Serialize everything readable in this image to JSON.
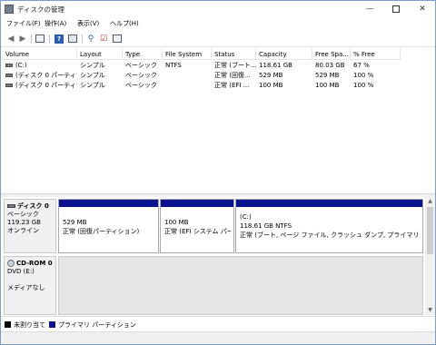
{
  "window": {
    "title": "ディスクの管理",
    "controls": {
      "minimize": "—",
      "close": "✕"
    }
  },
  "menu": [
    "ファイル(F)",
    "操作(A)",
    "表示(V)",
    "ヘルプ(H)"
  ],
  "toolbar_icons": [
    "back-arrow-icon",
    "forward-arrow-icon",
    "properties-icon",
    "help-icon",
    "grid-view-icon",
    "connect-icon",
    "check-icon",
    "view-icon"
  ],
  "columns": [
    "Volume",
    "Layout",
    "Type",
    "File System",
    "Status",
    "Capacity",
    "Free Spa...",
    "% Free"
  ],
  "volumes": [
    {
      "volume": "(C:)",
      "layout": "シンプル",
      "type": "ベーシック",
      "fs": "NTFS",
      "status": "正常 (ブート...",
      "capacity": "118.61 GB",
      "free": "80.03 GB",
      "pct": "67 %"
    },
    {
      "volume": "(ディスク 0 パーティシ...",
      "layout": "シンプル",
      "type": "ベーシック",
      "fs": "",
      "status": "正常 (回復...",
      "capacity": "529 MB",
      "free": "529 MB",
      "pct": "100 %"
    },
    {
      "volume": "(ディスク 0 パーティシ...",
      "layout": "シンプル",
      "type": "ベーシック",
      "fs": "",
      "status": "正常 (EFI ...",
      "capacity": "100 MB",
      "free": "100 MB",
      "pct": "100 %"
    }
  ],
  "disk0": {
    "name": "ディスク 0",
    "type": "ベーシック",
    "size": "119.23 GB",
    "state": "オンライン",
    "partitions": [
      {
        "label": "",
        "size": "529 MB",
        "status": "正常 (回復パーティション)"
      },
      {
        "label": "",
        "size": "100 MB",
        "status": "正常 (EFI システム パーティ"
      },
      {
        "label": "(C:)",
        "size": "118.61 GB NTFS",
        "status": "正常 (ブート, ページ ファイル, クラッシュ ダンプ, プライマリ パーティション"
      }
    ]
  },
  "cdrom0": {
    "name": "CD-ROM 0",
    "drive": "DVD (E:)",
    "media": "メディアなし"
  },
  "legend": {
    "unallocated": "未割り当て",
    "primary": "プライマリ パーティション"
  },
  "colors": {
    "primary_partition": "#0a1490",
    "unallocated": "#000000"
  }
}
